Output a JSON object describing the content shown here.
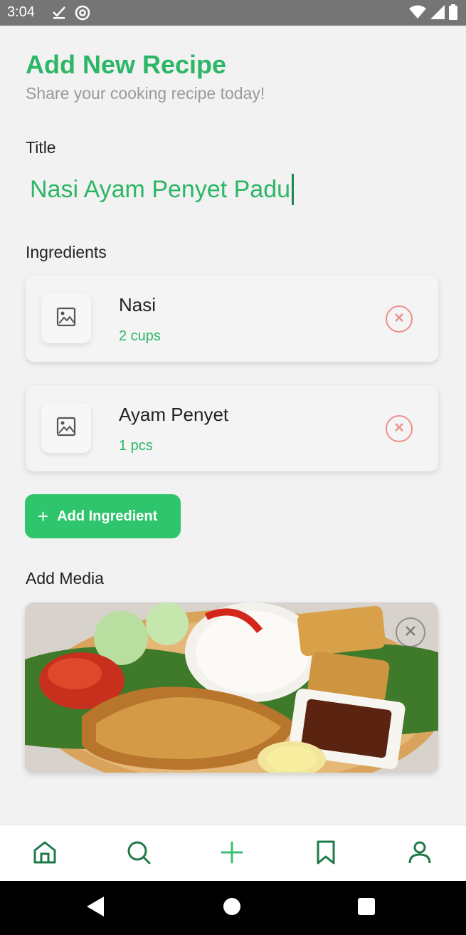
{
  "status_bar": {
    "time": "3:04",
    "icons_left": [
      "check-download-icon",
      "at-icon"
    ],
    "icons_right": [
      "wifi-icon",
      "signal-icon",
      "battery-icon"
    ]
  },
  "header": {
    "title": "Add New Recipe",
    "subtitle": "Share your cooking recipe today!"
  },
  "title_section": {
    "label": "Title",
    "value": "Nasi Ayam Penyet Padu"
  },
  "ingredients_section": {
    "label": "Ingredients",
    "items": [
      {
        "name": "Nasi",
        "quantity": "2 cups"
      },
      {
        "name": "Ayam Penyet",
        "quantity": "1 pcs"
      }
    ],
    "add_button_label": "Add Ingredient"
  },
  "media_section": {
    "label": "Add Media",
    "image": "food-photo"
  },
  "bottom_nav": {
    "items": [
      "home-icon",
      "search-icon",
      "add-icon",
      "bookmark-icon",
      "profile-icon"
    ]
  },
  "colors": {
    "accent": "#2cb665",
    "button": "#2ec56c",
    "remove": "#ec8f8a"
  }
}
